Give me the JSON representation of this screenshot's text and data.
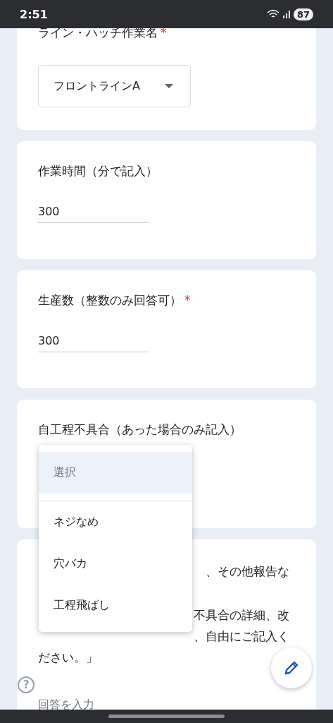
{
  "status_bar": {
    "time": "2:51",
    "battery": "87"
  },
  "questions": [
    {
      "kind": "dropdown",
      "title": "ライン・ハッチ作業名",
      "required_mark": "*",
      "value": "フロントラインA"
    },
    {
      "kind": "number",
      "title": "作業時間（分で記入）",
      "value": "300"
    },
    {
      "kind": "number",
      "title": "生産数（整数のみ回答可）",
      "required_mark": "*",
      "value": "300"
    },
    {
      "kind": "open_dropdown",
      "title": "自工程不具合（あった場合のみ記入）"
    }
  ],
  "menu": {
    "options": [
      {
        "label": "選択",
        "placeholder": true,
        "selected": true
      },
      {
        "label": "ネジなめ",
        "placeholder": false,
        "selected": false
      },
      {
        "label": "穴バカ",
        "placeholder": false,
        "selected": false
      },
      {
        "label": "工程飛ばし",
        "placeholder": false,
        "selected": false
      }
    ]
  },
  "last_question": {
    "title_visible": "、その他報告な",
    "description_lines": [
      "不具合の詳細、改",
      "、自由にご記入く"
    ],
    "description_end": "ださい。」",
    "placeholder": "回答を入力"
  },
  "help_glyph": "?"
}
